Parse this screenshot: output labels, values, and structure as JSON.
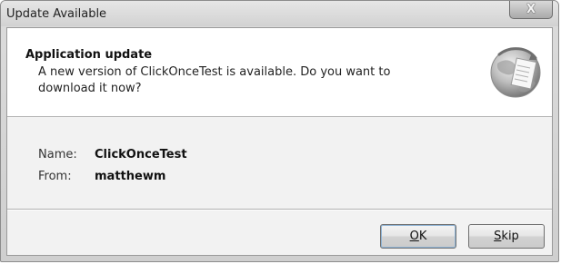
{
  "window": {
    "title": "Update Available",
    "close_label": "X"
  },
  "header": {
    "title": "Application update",
    "description": "A new version of ClickOnceTest is available. Do you want to download it now?",
    "icon": "globe-update-icon"
  },
  "details": {
    "name_label": "Name:",
    "name_value": "ClickOnceTest",
    "from_label": "From:",
    "from_value": "matthewm"
  },
  "buttons": {
    "ok_mnemonic": "O",
    "ok_rest": "K",
    "skip_mnemonic": "S",
    "skip_rest": "kip"
  },
  "colors": {
    "header_background": "#ffffff",
    "body_background": "#f2f2f2",
    "frame": "#d2d2d2"
  }
}
